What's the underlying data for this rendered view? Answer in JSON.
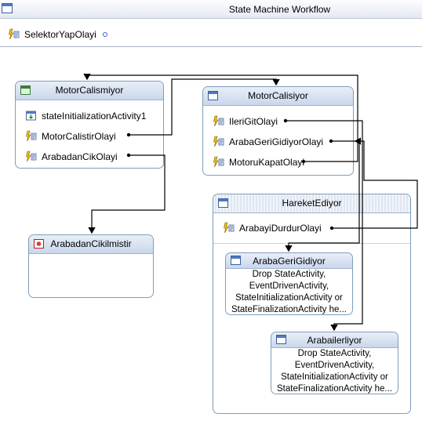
{
  "window": {
    "title": "State Machine Workflow"
  },
  "toolbar": {
    "event_label": "SelektorYapOlayi"
  },
  "states": {
    "motor_calismiyor": {
      "title": "MotorCalismiyor",
      "items": [
        "stateInitializationActivity1",
        "MotorCalistirOlayi",
        "ArabadanCikOlayi"
      ]
    },
    "motor_calisiyor": {
      "title": "MotorCalisiyor",
      "items": [
        "IleriGitOlayi",
        "ArabaGeriGidiyorOlayi",
        "MotoruKapatOlayi"
      ]
    },
    "arabadan_cikilmistir": {
      "title": "ArabadanCikilmistir"
    },
    "hareket_ediyor": {
      "title": "HareketEdiyor",
      "items": [
        "ArabayiDurdurOlayi"
      ],
      "children": {
        "araba_geri_gidiyor": {
          "title": "ArabaGeriGidiyor",
          "lines": [
            "Drop StateActivity,",
            "EventDrivenActivity,",
            "StateInitializationActivity or",
            "StateFinalizationActivity he..."
          ]
        },
        "araba_ilerliyor": {
          "title": "Arabailerliyor",
          "lines": [
            "Drop StateActivity,",
            "EventDrivenActivity,",
            "StateInitializationActivity or",
            "StateFinalizationActivity he..."
          ]
        }
      }
    }
  },
  "colors": {
    "border": "#7f9db9",
    "header_top": "#e9eff8",
    "header_bottom": "#c9d7eb",
    "link": "#000000",
    "accent": "#3b5cd6"
  },
  "icons": {
    "event": "lightning-event-icon",
    "init": "state-initialization-icon",
    "state": "state-icon",
    "final": "final-state-icon",
    "initial": "initial-state-icon"
  }
}
